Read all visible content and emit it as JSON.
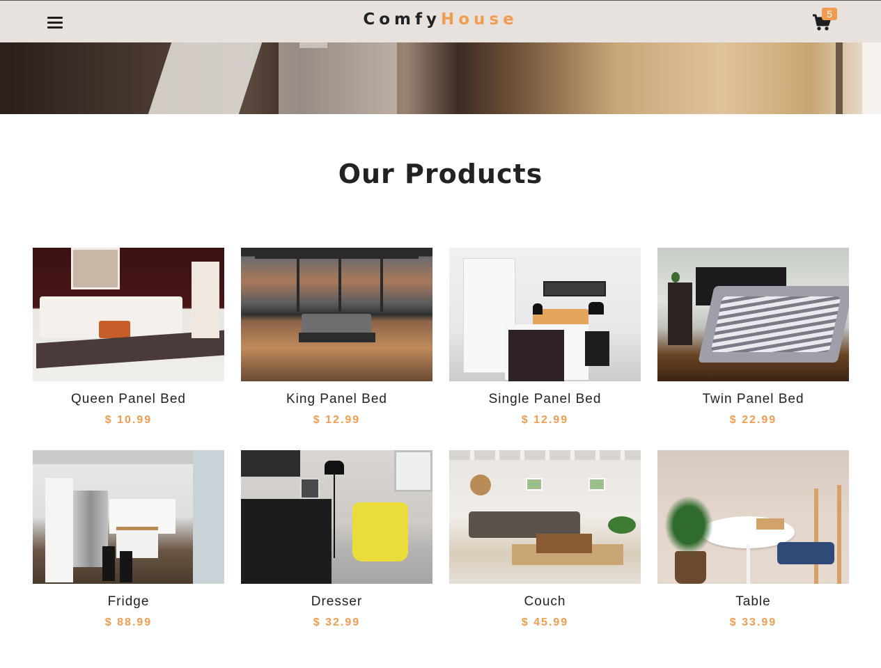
{
  "navbar": {
    "brand_part1": "Comfy",
    "brand_part2": "House",
    "cart_count": "5"
  },
  "colors": {
    "accent": "#f09d51",
    "navbar_bg": "#e7e2dd",
    "text": "#222222"
  },
  "icons": {
    "menu": "menu-icon",
    "cart": "cart-icon"
  },
  "products_section": {
    "title": "Our Products",
    "items": [
      {
        "name": "Queen Panel Bed",
        "price": "$ 10.99"
      },
      {
        "name": "King Panel Bed",
        "price": "$ 12.99"
      },
      {
        "name": "Single Panel Bed",
        "price": "$ 12.99"
      },
      {
        "name": "Twin Panel Bed",
        "price": "$ 22.99"
      },
      {
        "name": "Fridge",
        "price": "$ 88.99"
      },
      {
        "name": "Dresser",
        "price": "$ 32.99"
      },
      {
        "name": "Couch",
        "price": "$ 45.99"
      },
      {
        "name": "Table",
        "price": "$ 33.99"
      }
    ]
  }
}
